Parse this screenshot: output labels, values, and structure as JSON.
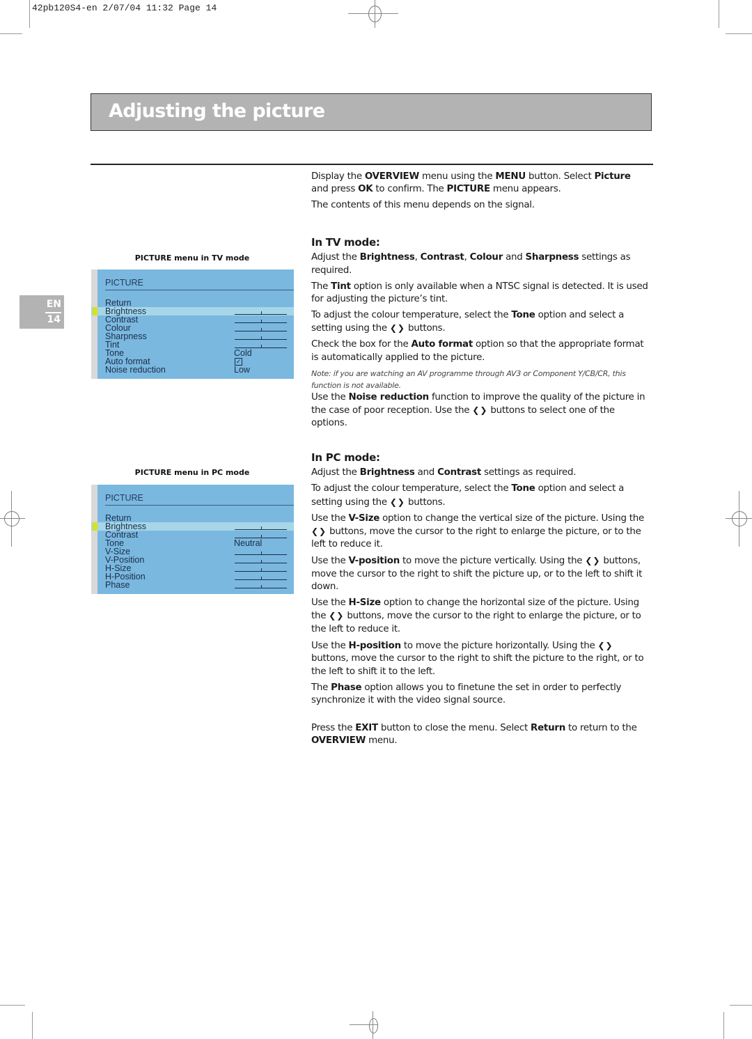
{
  "print_header": "42pb120S4-en  2/07/04  11:32  Page 14",
  "title": "Adjusting the picture",
  "page_tab": {
    "lang": "EN",
    "page": "14"
  },
  "tv_menu": {
    "caption": "PICTURE menu in TV mode",
    "title": "PICTURE",
    "selected": "Brightness",
    "rows": [
      {
        "label": "Return",
        "type": "none"
      },
      {
        "label": "Brightness",
        "type": "slider",
        "value": 0.5
      },
      {
        "label": "Contrast",
        "type": "slider",
        "value": 0.5
      },
      {
        "label": "Colour",
        "type": "slider",
        "value": 0.5
      },
      {
        "label": "Sharpness",
        "type": "slider",
        "value": 0.5
      },
      {
        "label": "Tint",
        "type": "slider",
        "value": 0.5
      },
      {
        "label": "Tone",
        "type": "text",
        "value": "Cold"
      },
      {
        "label": "Auto format",
        "type": "checkbox",
        "value": "☑"
      },
      {
        "label": "Noise reduction",
        "type": "text",
        "value": "Low"
      }
    ]
  },
  "pc_menu": {
    "caption": "PICTURE menu in PC mode",
    "title": "PICTURE",
    "selected": "Brightness",
    "rows": [
      {
        "label": "Return",
        "type": "none"
      },
      {
        "label": "Brightness",
        "type": "slider",
        "value": 0.5
      },
      {
        "label": "Contrast",
        "type": "slider",
        "value": 0.5
      },
      {
        "label": "Tone",
        "type": "text",
        "value": "Neutral"
      },
      {
        "label": "V-Size",
        "type": "slider",
        "value": 0.5
      },
      {
        "label": "V-Position",
        "type": "slider",
        "value": 0.5
      },
      {
        "label": "H-Size",
        "type": "slider",
        "value": 0.5
      },
      {
        "label": "H-Position",
        "type": "slider",
        "value": 0.5
      },
      {
        "label": "Phase",
        "type": "slider",
        "value": 0.5
      }
    ]
  },
  "text": {
    "intro": [
      [
        [
          "Display the ",
          false
        ],
        [
          "OVERVIEW",
          true
        ],
        [
          " menu using the ",
          false
        ],
        [
          "MENU",
          true
        ],
        [
          " button. Select ",
          false
        ],
        [
          "Picture",
          true
        ],
        [
          " and press ",
          false
        ],
        [
          "OK",
          true
        ],
        [
          " to confirm. The ",
          false
        ],
        [
          "PICTURE",
          true
        ],
        [
          " menu appears.",
          false
        ]
      ],
      [
        [
          "The contents of this menu depends on the signal.",
          false
        ]
      ]
    ],
    "tv_heading": "In TV mode:",
    "tv": [
      [
        [
          "Adjust the ",
          false
        ],
        [
          "Brightness",
          true
        ],
        [
          ", ",
          false
        ],
        [
          "Contrast",
          true
        ],
        [
          ", ",
          false
        ],
        [
          "Colour",
          true
        ],
        [
          " and ",
          false
        ],
        [
          "Sharpness",
          true
        ],
        [
          " settings as required.",
          false
        ]
      ],
      [
        [
          "The ",
          false
        ],
        [
          "Tint",
          true
        ],
        [
          " option is only available when a NTSC signal is detected. It is used for adjusting the picture’s tint.",
          false
        ]
      ],
      [
        [
          "To adjust the colour temperature, select the ",
          false
        ],
        [
          "Tone",
          true
        ],
        [
          " option and select a setting using the ",
          false
        ],
        [
          "‹›",
          "arrows"
        ],
        [
          " buttons.",
          false
        ]
      ],
      [
        [
          "Check the box for the ",
          false
        ],
        [
          "Auto format",
          true
        ],
        [
          " option so that the appropriate format is automatically applied to the picture.",
          false
        ]
      ]
    ],
    "tv_note": "Note: if you are watching an AV programme through AV3 or Component Y/CB/CR, this function is not available.",
    "tv_after_note": [
      [
        [
          "Use the ",
          false
        ],
        [
          "Noise reduction",
          true
        ],
        [
          " function to improve the quality of the picture in the case of poor reception. Use the ",
          false
        ],
        [
          "‹›",
          "arrows"
        ],
        [
          " buttons to select one of the options.",
          false
        ]
      ]
    ],
    "pc_heading": "In PC mode:",
    "pc": [
      [
        [
          "Adjust the ",
          false
        ],
        [
          "Brightness",
          true
        ],
        [
          " and ",
          false
        ],
        [
          "Contrast",
          true
        ],
        [
          " settings as required.",
          false
        ]
      ],
      [
        [
          "To adjust the colour temperature, select the ",
          false
        ],
        [
          "Tone",
          true
        ],
        [
          " option and select a setting using the ",
          false
        ],
        [
          "‹›",
          "arrows"
        ],
        [
          " buttons.",
          false
        ]
      ],
      [
        [
          "Use the ",
          false
        ],
        [
          "V-Size",
          true
        ],
        [
          " option to change the vertical size of the picture. Using the ",
          false
        ],
        [
          "‹›",
          "arrows"
        ],
        [
          " buttons, move the cursor to the right to enlarge the picture, or to the left to reduce it.",
          false
        ]
      ],
      [
        [
          "Use the ",
          false
        ],
        [
          "V-position",
          true
        ],
        [
          " to move the picture vertically. Using the ",
          false
        ],
        [
          "‹›",
          "arrows"
        ],
        [
          " buttons, move the cursor to the right to shift the picture up, or to the left to shift it down.",
          false
        ]
      ],
      [
        [
          "Use the ",
          false
        ],
        [
          "H-Size",
          true
        ],
        [
          " option to change the horizontal size of the picture. Using the ",
          false
        ],
        [
          "‹›",
          "arrows"
        ],
        [
          " buttons, move the cursor to the right to enlarge the picture, or to the left to reduce it.",
          false
        ]
      ],
      [
        [
          "Use the ",
          false
        ],
        [
          "H-position",
          true
        ],
        [
          " to move the picture horizontally. Using the ",
          false
        ],
        [
          "‹›",
          "arrows"
        ],
        [
          " buttons, move the cursor to the right to shift the picture to the right, or to the left to shift it to the left.",
          false
        ]
      ],
      [
        [
          "The ",
          false
        ],
        [
          "Phase",
          true
        ],
        [
          " option allows you to finetune the set in order to perfectly synchronize it with the video signal source.",
          false
        ]
      ]
    ],
    "closing": [
      [
        [
          "Press the ",
          false
        ],
        [
          "EXIT",
          true
        ],
        [
          " button to close the menu. Select ",
          false
        ],
        [
          "Return",
          true
        ],
        [
          " to return to the ",
          false
        ],
        [
          "OVERVIEW",
          true
        ],
        [
          " menu.",
          false
        ]
      ]
    ]
  },
  "icons": {
    "left_right_arrows": "arrow-left-right-icon",
    "checkbox": "checkbox-checked-icon"
  },
  "colors": {
    "title_bar": "#b3b3b3",
    "menu_bg": "#7ab8e0",
    "menu_selected": "#a6d6e8",
    "menu_marker": "#d7e321"
  }
}
